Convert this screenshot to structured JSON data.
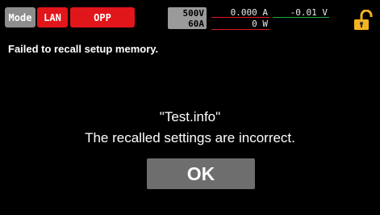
{
  "status_bar": {
    "mode_label": "Mode",
    "lan_label": "LAN",
    "opp_label": "OPP",
    "rating_voltage": "500V",
    "rating_current": "60A",
    "current_reading": "0.000 A",
    "voltage_reading": "-0.01 V",
    "power_reading": "0 W",
    "lock_icon": "unlocked-padlock-icon",
    "colors": {
      "red": "#e1161a",
      "green": "#1fa83a",
      "gray": "#8d8d8d",
      "lock_yellow": "#f3b322"
    }
  },
  "message": {
    "error_text": "Failed to recall setup memory.",
    "file_name": "\"Test.info\"",
    "detail_text": "The recalled settings are incorrect."
  },
  "dialog": {
    "ok_label": "OK"
  }
}
